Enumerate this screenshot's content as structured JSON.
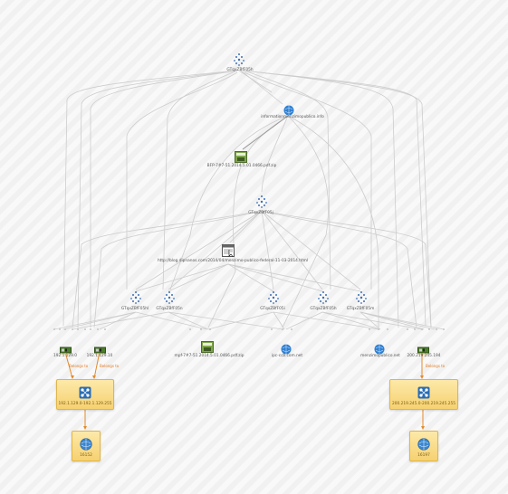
{
  "nodes": {
    "top_cluster": "GTqxZBfF05h",
    "info_site": "informationmenzimopublico.info",
    "dll1": "BFP-7#7-51.2014.5.01.0466.pdf.zip",
    "mid_cluster": "GTqxZBfF05j",
    "html_page": "http://blog.dipnanos.com/2014/04/menzimo-publico-federal-11-03-2014.html",
    "c1": "GTqxZBfF05hl",
    "c2": "GTqxZBfF05n",
    "c3": "GTqxZBfF05i",
    "c4": "GTqxZBfF05h",
    "c5": "GTqxZBfF05m",
    "ip1": "192.1.129.0",
    "ip2": "192.1.129.10",
    "zip2": "mpf-7#7-51.2014.5.01.0466.pdf.zip",
    "site2": "ipc-ccb.com.net",
    "site3": "menzimopublico.net",
    "ip3": "200.219.245.194",
    "range_left": "192.1.129.0-192.1.129.255",
    "range_right": "200.219.245.0-200.219.245.255",
    "as_left": "16152",
    "as_right": "16197"
  },
  "edge_labels": {
    "belongs1": "Belongs to",
    "belongs2": "Belongs to",
    "belongs3": "Belongs to"
  },
  "colors": {
    "edge": "#c9c9c9",
    "edge_dark": "#999999",
    "orange": "#e58a2b",
    "box_fill": "#f6d171"
  }
}
